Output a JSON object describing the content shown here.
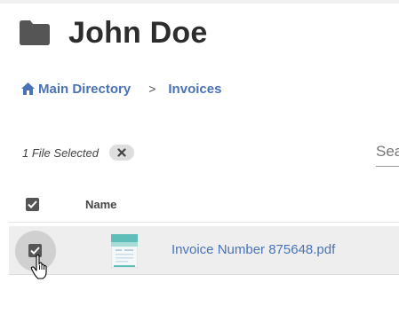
{
  "header": {
    "title": "John Doe",
    "icon": "folder-icon"
  },
  "breadcrumb": {
    "items": [
      {
        "label": "Main Directory",
        "icon": "home-icon"
      },
      {
        "label": "Invoices"
      }
    ],
    "separator": ">"
  },
  "selection": {
    "text": "1 File Selected",
    "clear_icon": "close-icon"
  },
  "search": {
    "placeholder": "Search"
  },
  "table": {
    "columns": [
      "",
      "Name"
    ],
    "rows": [
      {
        "name": "Invoice Number 875648.pdf",
        "selected": true,
        "icon": "file-thumbnail-icon"
      }
    ]
  },
  "colors": {
    "link": "#4a72b8",
    "row_selected_bg": "#eeeeee",
    "checkbox": "#555555"
  }
}
